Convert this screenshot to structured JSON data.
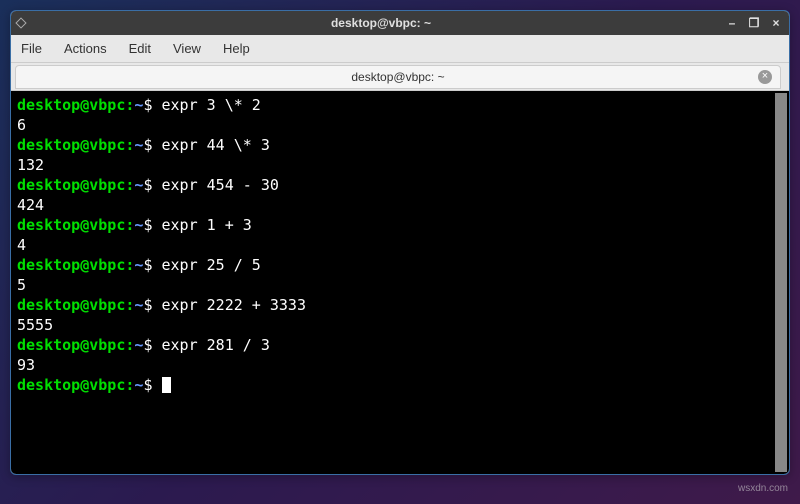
{
  "window": {
    "title": "desktop@vbpc: ~",
    "controls": {
      "minimize": "–",
      "maximize": "❐",
      "close": "×"
    }
  },
  "menubar": [
    "File",
    "Actions",
    "Edit",
    "View",
    "Help"
  ],
  "tab": {
    "label": "desktop@vbpc: ~",
    "close": "×"
  },
  "prompt": {
    "user": "desktop@vbpc",
    "colon": ":",
    "path": "~",
    "dollar": "$ "
  },
  "history": [
    {
      "cmd": "expr 3 \\* 2",
      "out": "6"
    },
    {
      "cmd": "expr 44 \\* 3",
      "out": "132"
    },
    {
      "cmd": "expr 454 - 30",
      "out": "424"
    },
    {
      "cmd": "expr 1 + 3",
      "out": "4"
    },
    {
      "cmd": "expr 25 / 5",
      "out": "5"
    },
    {
      "cmd": "expr 2222 + 3333",
      "out": "5555"
    },
    {
      "cmd": "expr 281 / 3",
      "out": "93"
    }
  ],
  "current_cmd": "",
  "watermark": "wsxdn.com"
}
